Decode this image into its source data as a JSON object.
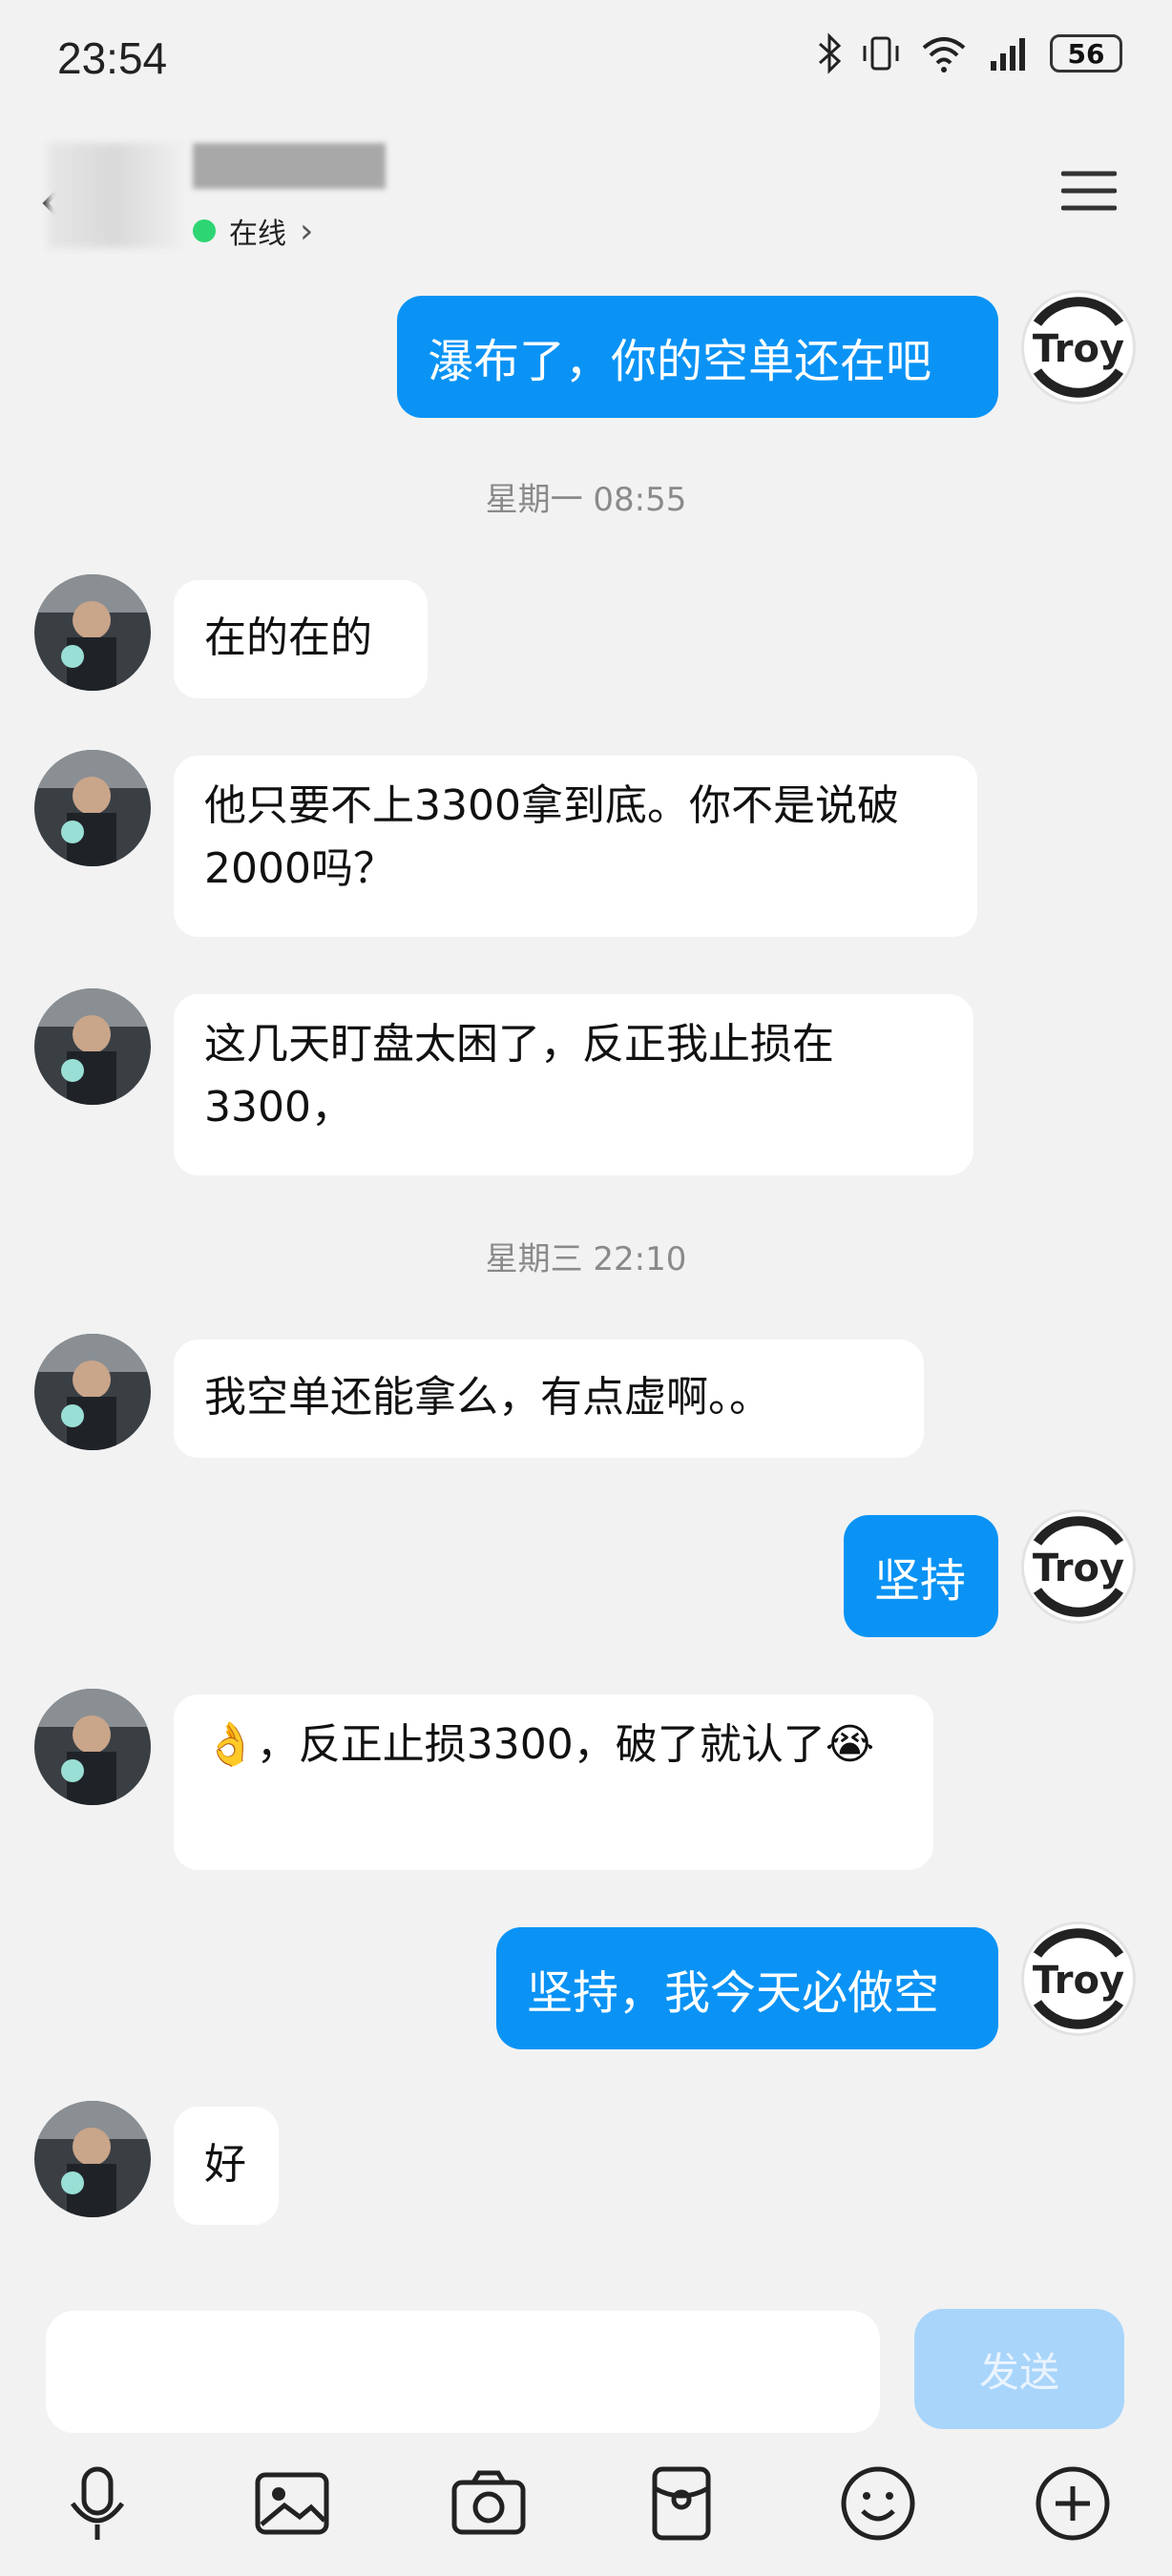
{
  "status_bar": {
    "time": "23:54",
    "battery": "56"
  },
  "header": {
    "status": "在线",
    "chevron": "›"
  },
  "timestamps": [
    "星期一 08:55",
    "星期三 22:10"
  ],
  "messages": [
    {
      "side": "out",
      "text": "瀑布了，你的空单还在吧"
    },
    {
      "side": "in",
      "text": "在的在的"
    },
    {
      "side": "in",
      "text": "他只要不上3300拿到底。你不是说破2000吗？"
    },
    {
      "side": "in",
      "text": "这几天盯盘太困了，反正我止损在3300，"
    },
    {
      "side": "in",
      "text": "我空单还能拿么，有点虚啊。。"
    },
    {
      "side": "out",
      "text": "坚持"
    },
    {
      "side": "in",
      "text": "👌，反正止损3300，破了就认了😭"
    },
    {
      "side": "out",
      "text": "坚持，我今天必做空"
    },
    {
      "side": "in",
      "text": "好"
    }
  ],
  "composer": {
    "send_label": "发送"
  },
  "colors": {
    "accent": "#0a93f5",
    "online": "#2ed573",
    "background": "#f2f2f2"
  }
}
